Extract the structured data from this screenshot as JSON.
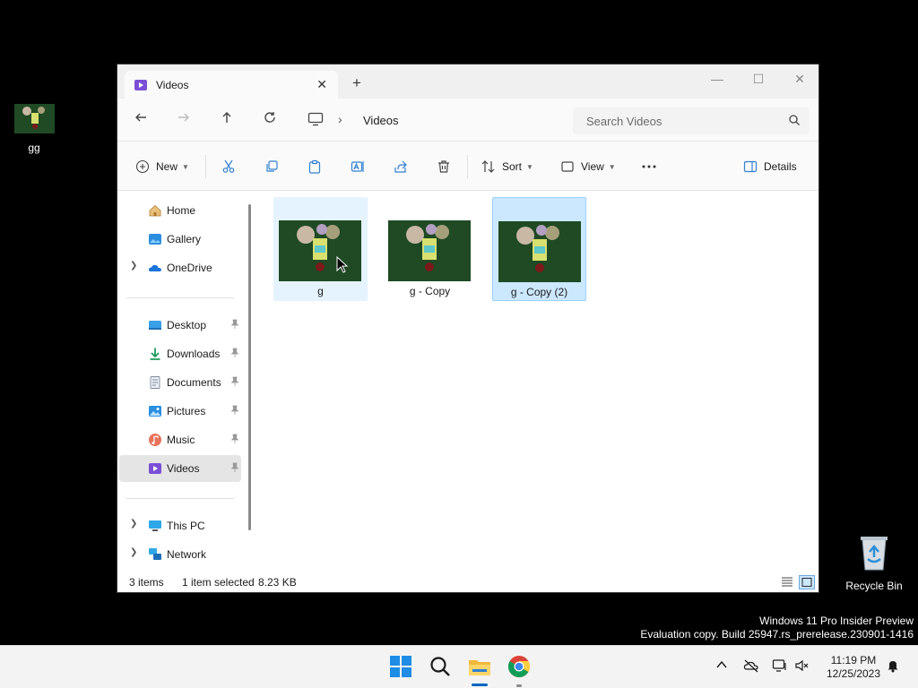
{
  "desktop": {
    "file_icon_label": "gg",
    "recycle_bin_label": "Recycle Bin"
  },
  "window": {
    "tab_title": "Videos",
    "new_tab_glyph": "+",
    "close_tab_glyph": "✕",
    "minimize_glyph": "—",
    "maximize_glyph": "☐",
    "close_glyph": "✕"
  },
  "address": {
    "crumb": "Videos",
    "search_placeholder": "Search Videos"
  },
  "toolbar": {
    "new_label": "New",
    "sort_label": "Sort",
    "view_label": "View",
    "details_label": "Details"
  },
  "sidebar": {
    "items": [
      {
        "label": "Home",
        "icon": "home-icon"
      },
      {
        "label": "Gallery",
        "icon": "gallery-icon"
      },
      {
        "label": "OneDrive",
        "icon": "cloud-icon",
        "expandable": true
      },
      {
        "label": "Desktop",
        "icon": "desktop-folder-icon",
        "pinned": true
      },
      {
        "label": "Downloads",
        "icon": "download-icon",
        "pinned": true
      },
      {
        "label": "Documents",
        "icon": "documents-icon",
        "pinned": true
      },
      {
        "label": "Pictures",
        "icon": "pictures-icon",
        "pinned": true
      },
      {
        "label": "Music",
        "icon": "music-icon",
        "pinned": true
      },
      {
        "label": "Videos",
        "icon": "videos-icon",
        "pinned": true,
        "selected": true
      },
      {
        "label": "This PC",
        "icon": "this-pc-icon",
        "expandable": true
      },
      {
        "label": "Network",
        "icon": "network-icon",
        "expandable": true
      }
    ]
  },
  "files": [
    {
      "name": "g",
      "state": "hover"
    },
    {
      "name": "g - Copy",
      "state": "normal"
    },
    {
      "name": "g - Copy (2)",
      "state": "selected"
    }
  ],
  "status": {
    "item_count": "3 items",
    "selection": "1 item selected",
    "size": "8.23 KB"
  },
  "watermark": {
    "line1": "Windows 11 Pro Insider Preview",
    "line2": "Evaluation copy. Build 25947.rs_prerelease.230901-1416"
  },
  "clock": {
    "time": "11:19 PM",
    "date": "12/25/2023"
  },
  "colors": {
    "selection_bg": "#cce8ff",
    "selection_border": "#99d1ff",
    "accent": "#0067c0"
  }
}
